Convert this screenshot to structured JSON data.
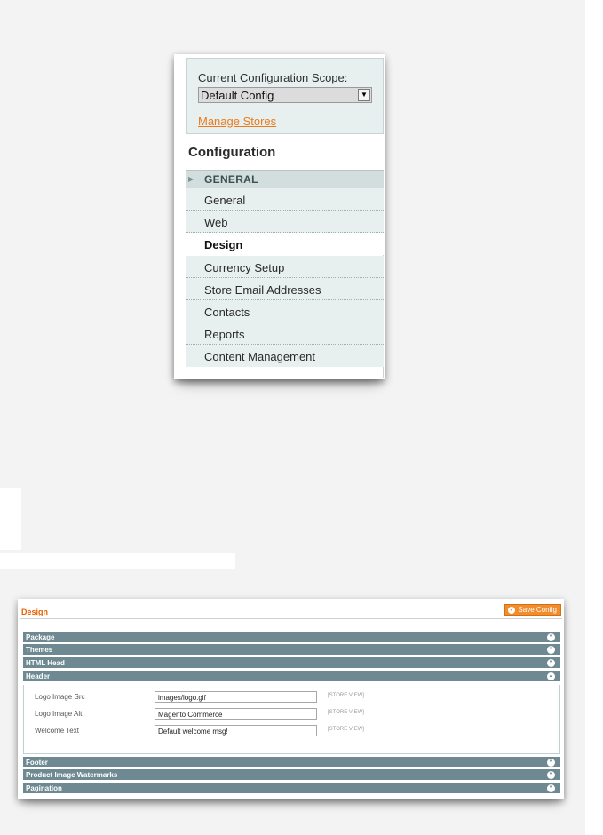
{
  "sidebar": {
    "scope_label": "Current Configuration Scope:",
    "scope_value": "Default Config",
    "manage_stores": "Manage Stores",
    "title": "Configuration",
    "section": "GENERAL",
    "items": [
      {
        "label": "General"
      },
      {
        "label": "Web"
      },
      {
        "label": "Design",
        "active": true
      },
      {
        "label": "Currency Setup"
      },
      {
        "label": "Store Email Addresses"
      },
      {
        "label": "Contacts"
      },
      {
        "label": "Reports"
      },
      {
        "label": "Content Management"
      }
    ]
  },
  "design": {
    "title": "Design",
    "save_label": "Save Config",
    "groups_top": [
      {
        "label": "Package",
        "state": "collapsed"
      },
      {
        "label": "Themes",
        "state": "collapsed"
      },
      {
        "label": "HTML Head",
        "state": "collapsed"
      },
      {
        "label": "Header",
        "state": "expanded"
      }
    ],
    "fields": [
      {
        "label": "Logo Image Src",
        "value": "images/logo.gif",
        "scope": "[STORE VIEW]"
      },
      {
        "label": "Logo Image Alt",
        "value": "Magento Commerce",
        "scope": "[STORE VIEW]"
      },
      {
        "label": "Welcome Text",
        "value": "Default welcome msg!",
        "scope": "[STORE VIEW]"
      }
    ],
    "groups_bottom": [
      {
        "label": "Footer",
        "state": "collapsed"
      },
      {
        "label": "Product Image Watermarks",
        "state": "collapsed"
      },
      {
        "label": "Pagination",
        "state": "collapsed"
      }
    ]
  },
  "colors": {
    "accent": "#eb5e00",
    "bar": "#6f8992",
    "nav_bg": "#e7efef"
  }
}
